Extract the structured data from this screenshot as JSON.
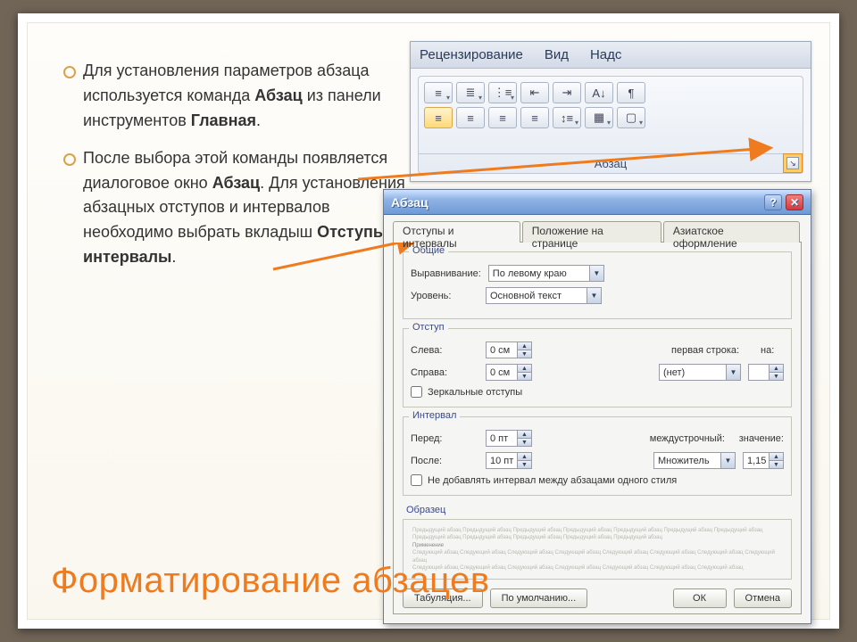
{
  "title": "Форматирование абзацев",
  "bullets": [
    {
      "pre": "Для установления параметров абзаца используется команда ",
      "b1": "Абзац",
      "mid": " из панели инструментов ",
      "b2": "Главная",
      "post": "."
    },
    {
      "pre": "После выбора этой команды появляется диалоговое окно ",
      "b1": "Абзац",
      "mid": ". Для установления абзацных отступов и интервалов необходимо выбрать вкладыш ",
      "b2": "Отступы и интервалы",
      "post": "."
    }
  ],
  "ribbon": {
    "tabs": [
      "Рецензирование",
      "Вид",
      "Надс"
    ],
    "group_label": "Абзац"
  },
  "dialog": {
    "title": "Абзац",
    "tabs": [
      "Отступы и интервалы",
      "Положение на странице",
      "Азиатское оформление"
    ],
    "g_general": "Общие",
    "align_label": "Выравнивание:",
    "align_value": "По левому краю",
    "level_label": "Уровень:",
    "level_value": "Основной текст",
    "g_indent": "Отступ",
    "left_label": "Слева:",
    "left_value": "0 см",
    "right_label": "Справа:",
    "right_value": "0 см",
    "firstline_label": "первая строка:",
    "firstline_value": "(нет)",
    "by_label": "на:",
    "by_value": "",
    "mirror_label": "Зеркальные отступы",
    "g_spacing": "Интервал",
    "before_label": "Перед:",
    "before_value": "0 пт",
    "after_label": "После:",
    "after_value": "10 пт",
    "linesp_label": "междустрочный:",
    "linesp_value": "Множитель",
    "val_label": "значение:",
    "val_value": "1,15",
    "noadd_label": "Не добавлять интервал между абзацами одного стиля",
    "g_preview": "Образец",
    "btn_tab": "Табуляция...",
    "btn_default": "По умолчанию...",
    "btn_ok": "ОК",
    "btn_cancel": "Отмена"
  }
}
